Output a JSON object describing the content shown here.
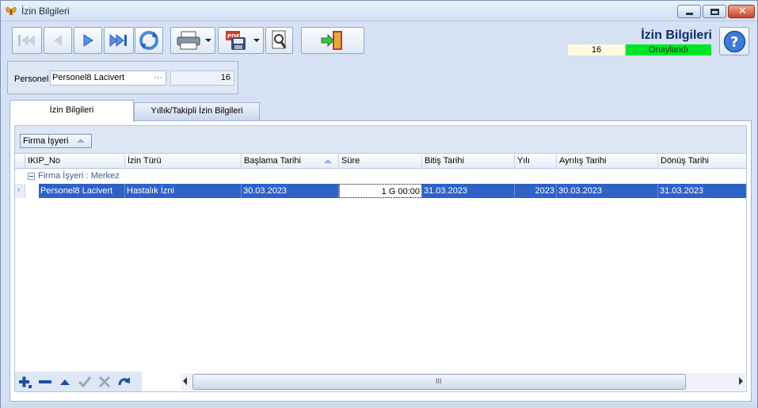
{
  "window": {
    "title": "İzin Bilgileri",
    "close_glyph": "✕"
  },
  "toolbar": {
    "buttons": [
      {
        "name": "first-record-icon"
      },
      {
        "name": "previous-record-icon"
      },
      {
        "name": "next-record-icon"
      },
      {
        "name": "last-record-icon"
      },
      {
        "name": "refresh-icon"
      },
      {
        "name": "print-icon"
      },
      {
        "name": "pdf-export-icon"
      },
      {
        "name": "preview-search-icon"
      },
      {
        "name": "exit-door-icon"
      }
    ]
  },
  "header": {
    "title": "İzin Bilgileri",
    "record_id": "16",
    "status": "Onaylandı",
    "status_color": "#00e52a",
    "help_glyph": "?"
  },
  "personel": {
    "label": "Personel",
    "value": "Personel8 Lacivert",
    "dots": "···",
    "id": "16"
  },
  "tabs": [
    {
      "label": "İzin Bilgileri",
      "active": true
    },
    {
      "label": "Yıllık/Takipli İzin Bilgileri",
      "active": false
    }
  ],
  "grid": {
    "group_by_label": "Firma İşyeri",
    "columns": [
      "IKIP_No",
      "İzin Türü",
      "Başlama Tarihi",
      "Süre",
      "Bitiş Tarihi",
      "Yılı",
      "Ayrılış Tarihi",
      "Dönüş Tarihi"
    ],
    "group_row": "Firma İşyeri : Merkez",
    "rows": [
      {
        "ikip_no": "Personel8 Lacivert",
        "izin_turu": "Hastalık İzni",
        "baslama": "30.03.2023",
        "sure": "1 G 00:00",
        "bitis": "31.03.2023",
        "yili": "2023",
        "ayrilis": "30.03.2023",
        "donus": "31.03.2023"
      }
    ],
    "row_indicator": "›",
    "selection_color": "#2f62c7"
  },
  "scrollbar": {
    "grip": "III"
  }
}
